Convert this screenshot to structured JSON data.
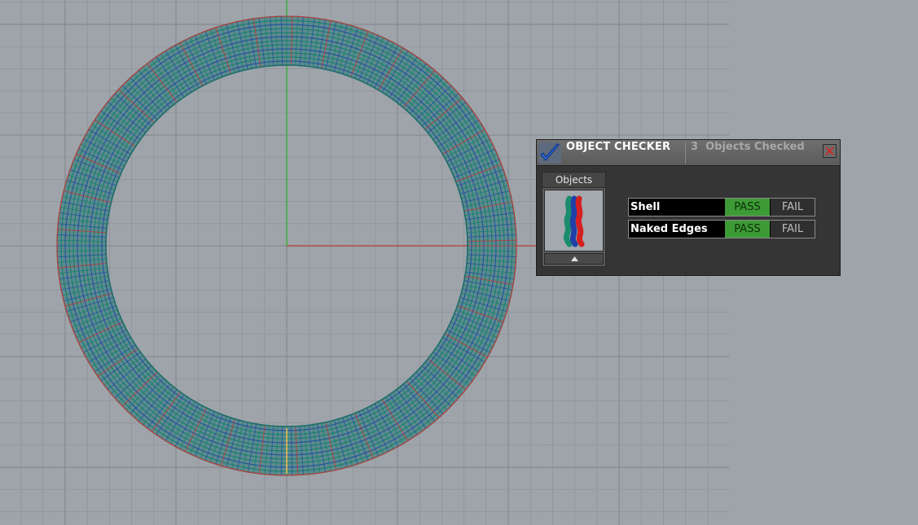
{
  "viewport": {
    "background_color": "#9ea4aa",
    "grid_color": "#8c9298",
    "x_axis_color": "#b5494a",
    "y_axis_color": "#3fae3f",
    "ring_colors": [
      "#12806e",
      "#1c4fa0",
      "#c8302c"
    ]
  },
  "object_checker": {
    "title": "OBJECT CHECKER",
    "summary": "3  Objects Checked",
    "check_icon": "checkmark-icon",
    "close_icon": "close-icon",
    "objects_header": "Objects",
    "thumbnail_colors": [
      "#1a8c6e",
      "#2040a8",
      "#d42020"
    ],
    "checks": [
      {
        "label": "Shell",
        "pass": "PASS",
        "fail": "FAIL",
        "result": "pass"
      },
      {
        "label": "Naked Edges",
        "pass": "PASS",
        "fail": "FAIL",
        "result": "pass"
      }
    ],
    "colors": {
      "pass": "#3d9b35",
      "fail": "#2f2f2f",
      "panel": "#353535"
    }
  }
}
